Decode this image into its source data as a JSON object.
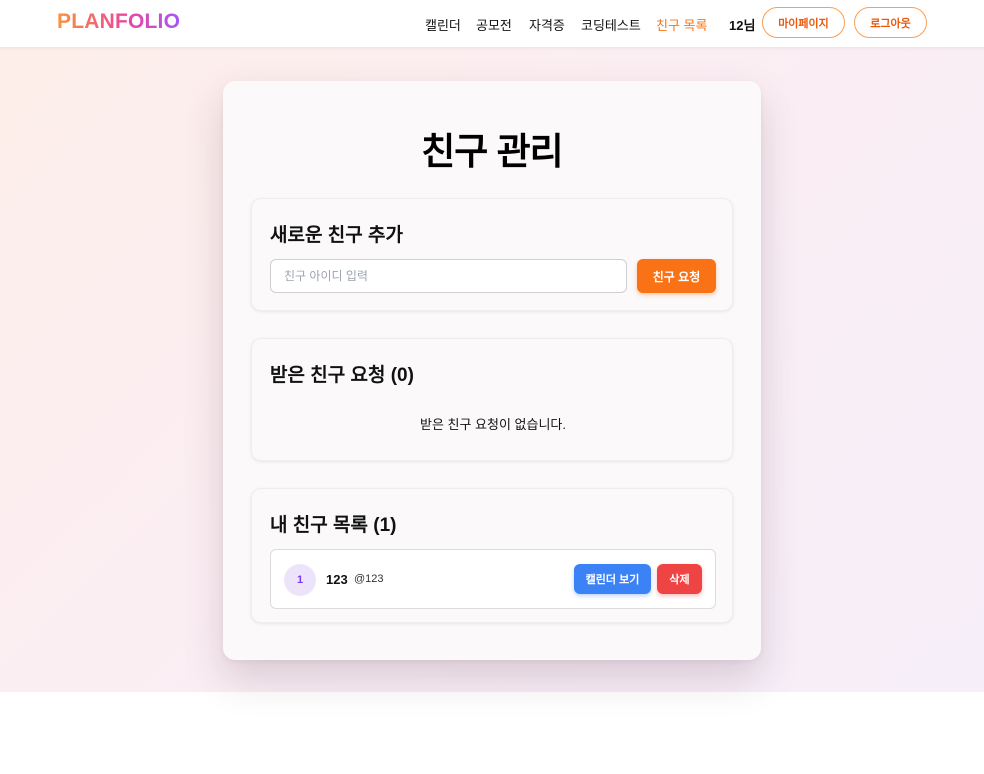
{
  "header": {
    "logo": "PLANFOLIO",
    "nav": [
      {
        "label": "캘린더",
        "active": false
      },
      {
        "label": "공모전",
        "active": false
      },
      {
        "label": "자격증",
        "active": false
      },
      {
        "label": "코딩테스트",
        "active": false
      },
      {
        "label": "친구 목록",
        "active": true
      }
    ],
    "user_name": "12님",
    "mypage_label": "마이페이지",
    "logout_label": "로그아웃"
  },
  "page": {
    "title": "친구 관리"
  },
  "add_friend": {
    "title": "새로운 친구 추가",
    "input_placeholder": "친구 아이디 입력",
    "input_value": "",
    "request_button": "친구 요청"
  },
  "received_requests": {
    "title": "받은 친구 요청 (0)",
    "empty_message": "받은 친구 요청이 없습니다."
  },
  "friend_list": {
    "title": "내 친구 목록 (1)",
    "friends": [
      {
        "avatar": "1",
        "name": "123",
        "handle": "@123",
        "calendar_button": "캘린더 보기",
        "delete_button": "삭제"
      }
    ]
  },
  "colors": {
    "accent": "#f97316",
    "calendar_button": "#3b82f6",
    "delete_button": "#ef4444",
    "avatar_bg": "#ede4fb",
    "avatar_text": "#7c3aed"
  }
}
